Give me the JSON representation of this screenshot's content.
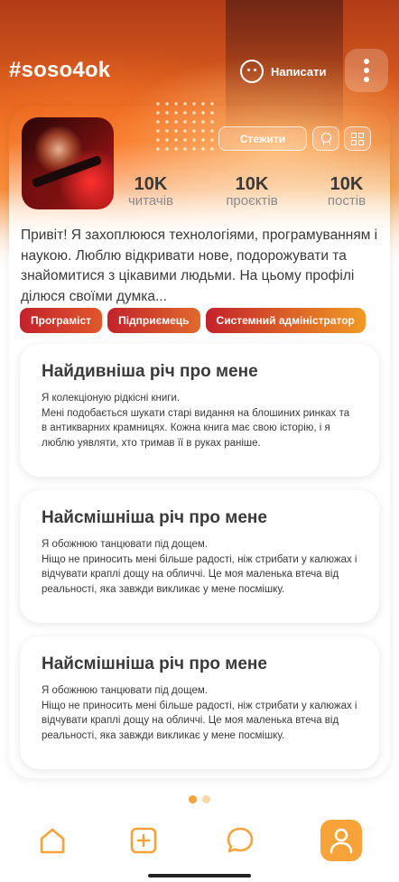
{
  "header": {
    "username": "#soso4ok",
    "write_label": "Написати"
  },
  "profile": {
    "follow_label": "Стежити",
    "stats": [
      {
        "value": "10K",
        "label": "читачів"
      },
      {
        "value": "10K",
        "label": "проєктів"
      },
      {
        "value": "10K",
        "label": "постів"
      }
    ],
    "bio": "Привіт! Я захоплююся технологіями, програмуванням і наукою. Люблю відкривати нове, подорожувати та знайомитися з цікавими людьми. На цьому профілі ділюся своїми думка...",
    "tags": [
      "Програміст",
      "Підприємець",
      "Системний адміністратор"
    ]
  },
  "facts": [
    {
      "title": "Найдивніша річ про мене",
      "lead": "Я колекціоную рідкісні книги.",
      "body": "Мені подобається шукати старі видання на блошиних ринках та в антикварних крамницях. Кожна книга має свою історію, і я люблю уявляти, хто тримав її в руках раніше."
    },
    {
      "title": "Найсмішніша річ про мене",
      "lead": "Я обожнюю танцювати під дощем.",
      "body": "Ніщо не приносить мені більше радості, ніж стрибати у калюжах і відчувати краплі дощу на обличчі. Це моя маленька втеча від реальності, яка завжди викликає у мене посмішку."
    },
    {
      "title": "Найсмішніша річ про мене",
      "lead": "Я обожнюю танцювати під дощем.",
      "body": "Ніщо не приносить мені більше радості, ніж стрибати у калюжах і відчувати краплі дощу на обличчі. Це моя маленька втеча від реальності, яка завжди викликає у мене посмішку."
    }
  ],
  "pager": {
    "current": 1,
    "total": 2
  },
  "tabs": [
    {
      "icon": "home-icon"
    },
    {
      "icon": "add-icon"
    },
    {
      "icon": "chat-icon"
    },
    {
      "icon": "profile-icon",
      "active": true
    }
  ],
  "colors": {
    "accent": "#f7a33a",
    "tag_red": "#c4222c"
  }
}
